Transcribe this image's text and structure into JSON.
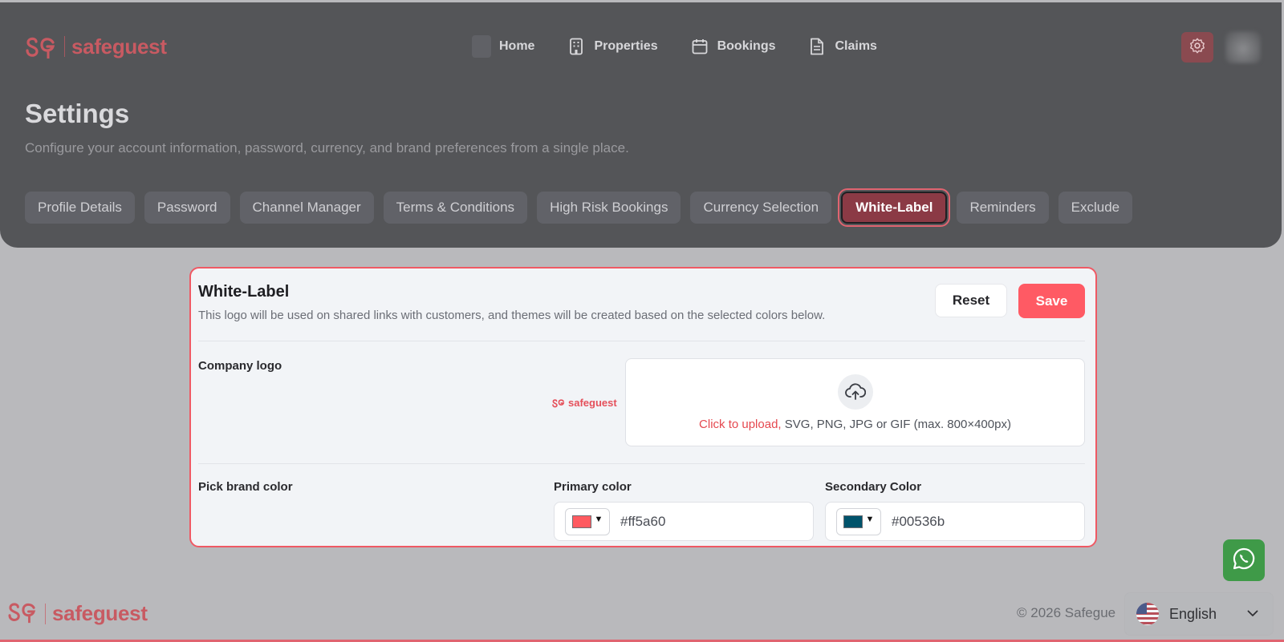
{
  "brand": {
    "name": "safeguest"
  },
  "nav": {
    "items": [
      {
        "label": "Home",
        "icon": "home-icon"
      },
      {
        "label": "Properties",
        "icon": "building-icon"
      },
      {
        "label": "Bookings",
        "icon": "calendar-icon"
      },
      {
        "label": "Claims",
        "icon": "document-icon"
      }
    ],
    "settings_icon": "gear-icon"
  },
  "page": {
    "title": "Settings",
    "description": "Configure your account information, password, currency, and brand preferences from a single place."
  },
  "tabs": [
    {
      "label": "Profile Details",
      "active": false
    },
    {
      "label": "Password",
      "active": false
    },
    {
      "label": "Channel Manager",
      "active": false
    },
    {
      "label": "Terms & Conditions",
      "active": false
    },
    {
      "label": "High Risk Bookings",
      "active": false
    },
    {
      "label": "Currency Selection",
      "active": false
    },
    {
      "label": "White-Label",
      "active": true
    },
    {
      "label": "Reminders",
      "active": false
    },
    {
      "label": "Exclude",
      "active": false
    }
  ],
  "white_label": {
    "title": "White-Label",
    "subtitle": "This logo will be used on shared links with customers, and themes will be created based on the selected colors below.",
    "reset_label": "Reset",
    "save_label": "Save",
    "company_logo_label": "Company logo",
    "logo_preview_text": "safeguest",
    "upload_link": "Click to upload,",
    "upload_hint": " SVG, PNG, JPG or GIF (max. 800×400px)",
    "brand_color_label": "Pick brand color",
    "primary": {
      "label": "Primary color",
      "value": "#ff5a60",
      "color": "#ff5a60"
    },
    "secondary": {
      "label": "Secondary Color",
      "value": "#00536b",
      "color": "#00536b"
    }
  },
  "footer": {
    "brand": "safeguest",
    "copyright": "© 2026 Safegue",
    "language": "English"
  },
  "colors": {
    "accent": "#ff5a64",
    "active_tab": "#8b3a45",
    "header_bg": "#545558"
  }
}
